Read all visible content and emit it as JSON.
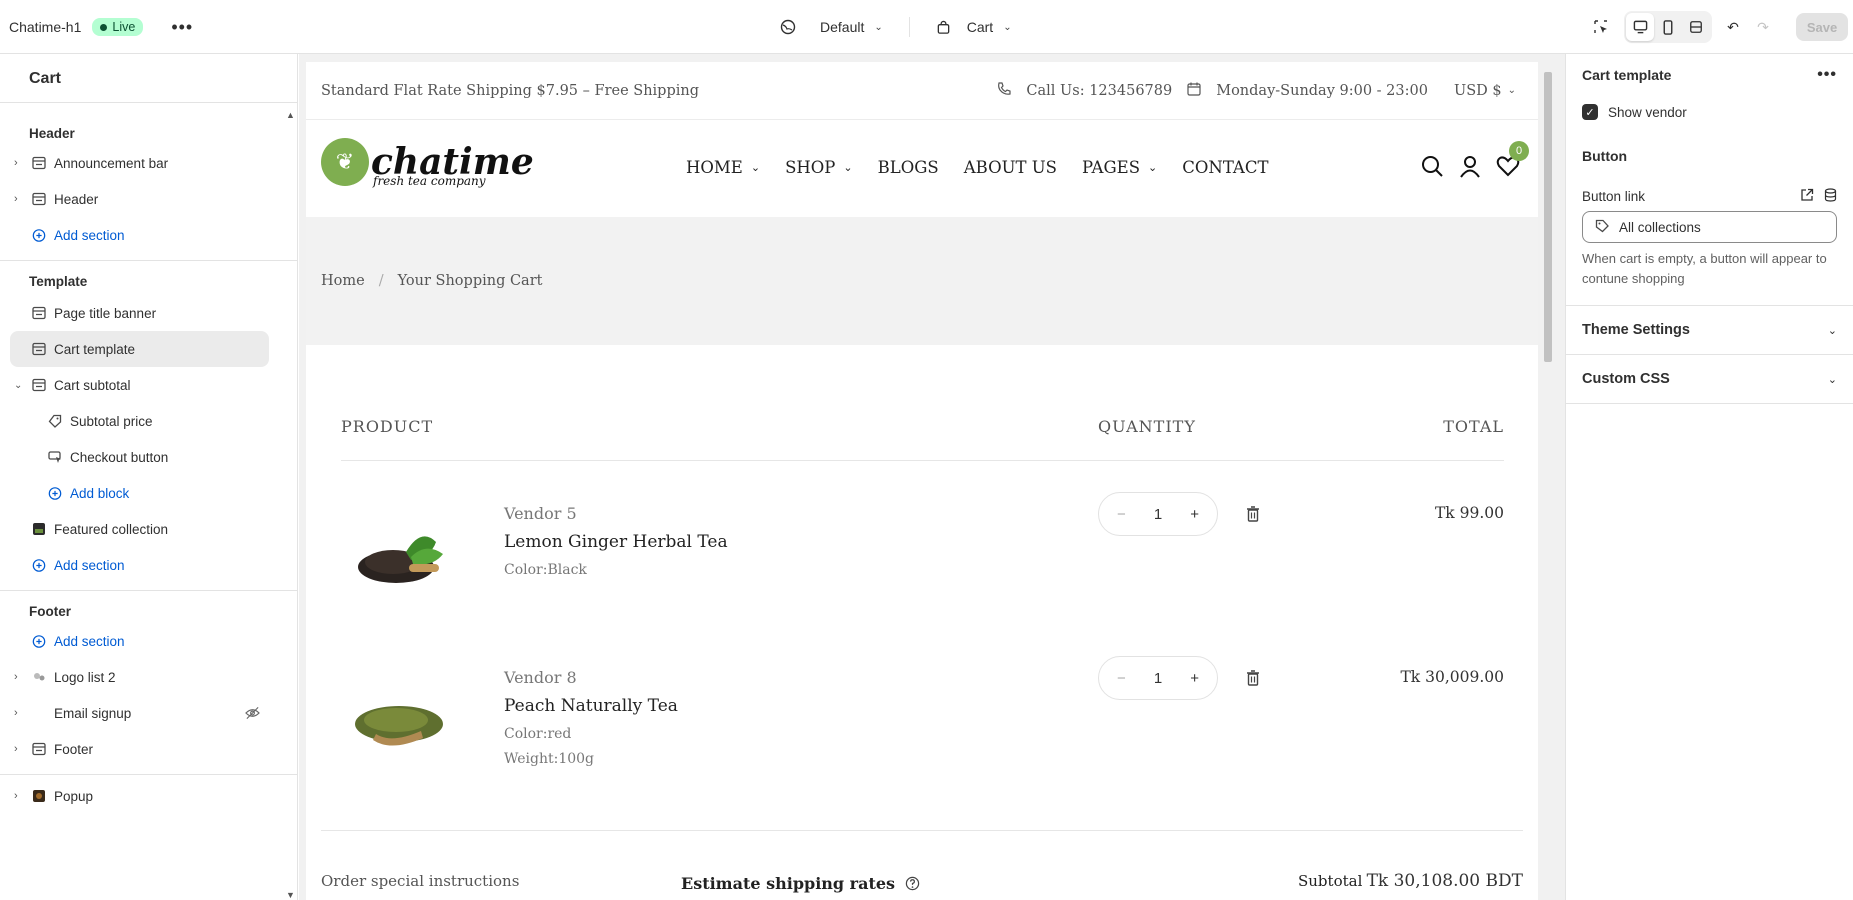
{
  "topbar": {
    "store_name": "Chatime-h1",
    "status": "Live",
    "theme_label": "Default",
    "page_label": "Cart",
    "save_label": "Save"
  },
  "sidebar": {
    "title": "Cart",
    "header_group": "Header",
    "header_items": [
      "Announcement bar",
      "Header"
    ],
    "add_section": "Add section",
    "template_group": "Template",
    "template_items": {
      "page_title_banner": "Page title banner",
      "cart_template": "Cart template",
      "cart_subtotal": "Cart subtotal",
      "subtotal_price": "Subtotal price",
      "checkout_button": "Checkout button",
      "add_block": "Add block",
      "featured_collection": "Featured collection"
    },
    "footer_group": "Footer",
    "footer_items": [
      "Logo list 2",
      "Email signup",
      "Footer"
    ],
    "popup": "Popup"
  },
  "store": {
    "announcement": "Standard Flat Rate Shipping $7.95 – Free Shipping",
    "call": "Call Us: 123456789",
    "hours": "Monday-Sunday 9:00 - 23:00",
    "currency": "USD $",
    "logo_word": "chatime",
    "logo_tag": "fresh tea company",
    "menu": [
      "HOME",
      "SHOP",
      "BLOGS",
      "ABOUT US",
      "PAGES",
      "CONTACT"
    ],
    "cart_count": "0",
    "breadcrumb_home": "Home",
    "breadcrumb_sep": "/",
    "breadcrumb_current": "Your Shopping Cart",
    "table_headers": {
      "product": "PRODUCT",
      "quantity": "QUANTITY",
      "total": "TOTAL"
    },
    "items": [
      {
        "vendor": "Vendor 5",
        "name": "Lemon Ginger Herbal Tea",
        "options": [
          "Color:Black"
        ],
        "qty": "1",
        "total": "Tk 99.00"
      },
      {
        "vendor": "Vendor 8",
        "name": "Peach Naturally Tea",
        "options": [
          "Color:red",
          "Weight:100g"
        ],
        "qty": "1",
        "total": "Tk 30,009.00"
      }
    ],
    "order_instructions": "Order special instructions",
    "estimate_shipping": "Estimate shipping rates",
    "subtotal_label": "Subtotal",
    "subtotal_value": "Tk 30,108.00 BDT"
  },
  "settings": {
    "title": "Cart template",
    "show_vendor": "Show vendor",
    "button_heading": "Button",
    "button_link_label": "Button link",
    "button_link_value": "All collections",
    "help": "When cart is empty, a button will appear to contune shopping",
    "theme_settings": "Theme Settings",
    "custom_css": "Custom CSS"
  }
}
